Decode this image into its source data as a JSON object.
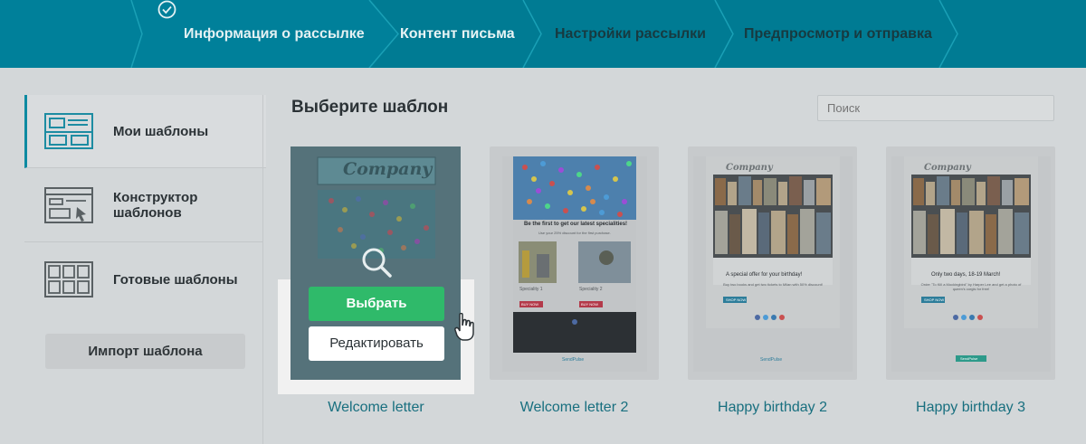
{
  "steps": {
    "info": "Информация о рассылке",
    "content": "Контент письма",
    "settings": "Настройки рассылки",
    "preview": "Предпросмотр и отправка"
  },
  "sidebar": {
    "items": [
      {
        "label": "Мои шаблоны",
        "icon": "layout-icon"
      },
      {
        "label": "Конструктор шаблонов",
        "icon": "constructor-icon"
      },
      {
        "label": "Готовые шаблоны",
        "icon": "grid-icon"
      }
    ],
    "import_label": "Импорт шаблона"
  },
  "main": {
    "title": "Выберите шаблон",
    "search_placeholder": "Поиск"
  },
  "templates": [
    {
      "name": "Welcome letter"
    },
    {
      "name": "Welcome letter 2"
    },
    {
      "name": "Happy birthday 2"
    },
    {
      "name": "Happy birthday 3"
    }
  ],
  "hover_actions": {
    "select_label": "Выбрать",
    "edit_label": "Редактировать"
  },
  "thumbs": {
    "company": "Company",
    "t2_headline": "Be the first to get our latest specialities!",
    "t2_sub": "Use your 25% discount for the first purchase.",
    "t2_spec1": "Speciality 1",
    "t2_spec2": "Speciality 2",
    "buy_now": "BUY NOW",
    "t3_headline": "A special offer for your birthday!",
    "t3_text": "Buy two books and get two tickets to Milan with 50% discount!",
    "shop_now": "SHOP NOW",
    "t4_headline": "Only two days, 18-19 March!",
    "t4_text": "Order \"To Kill a Mockingbird\" by Harper Lee and get a photo of queen's corgis for free!",
    "sendpulse": "SendPulse"
  },
  "colors": {
    "topbar": "#00809a",
    "accent": "#2fba6a",
    "link": "#186f7f"
  }
}
